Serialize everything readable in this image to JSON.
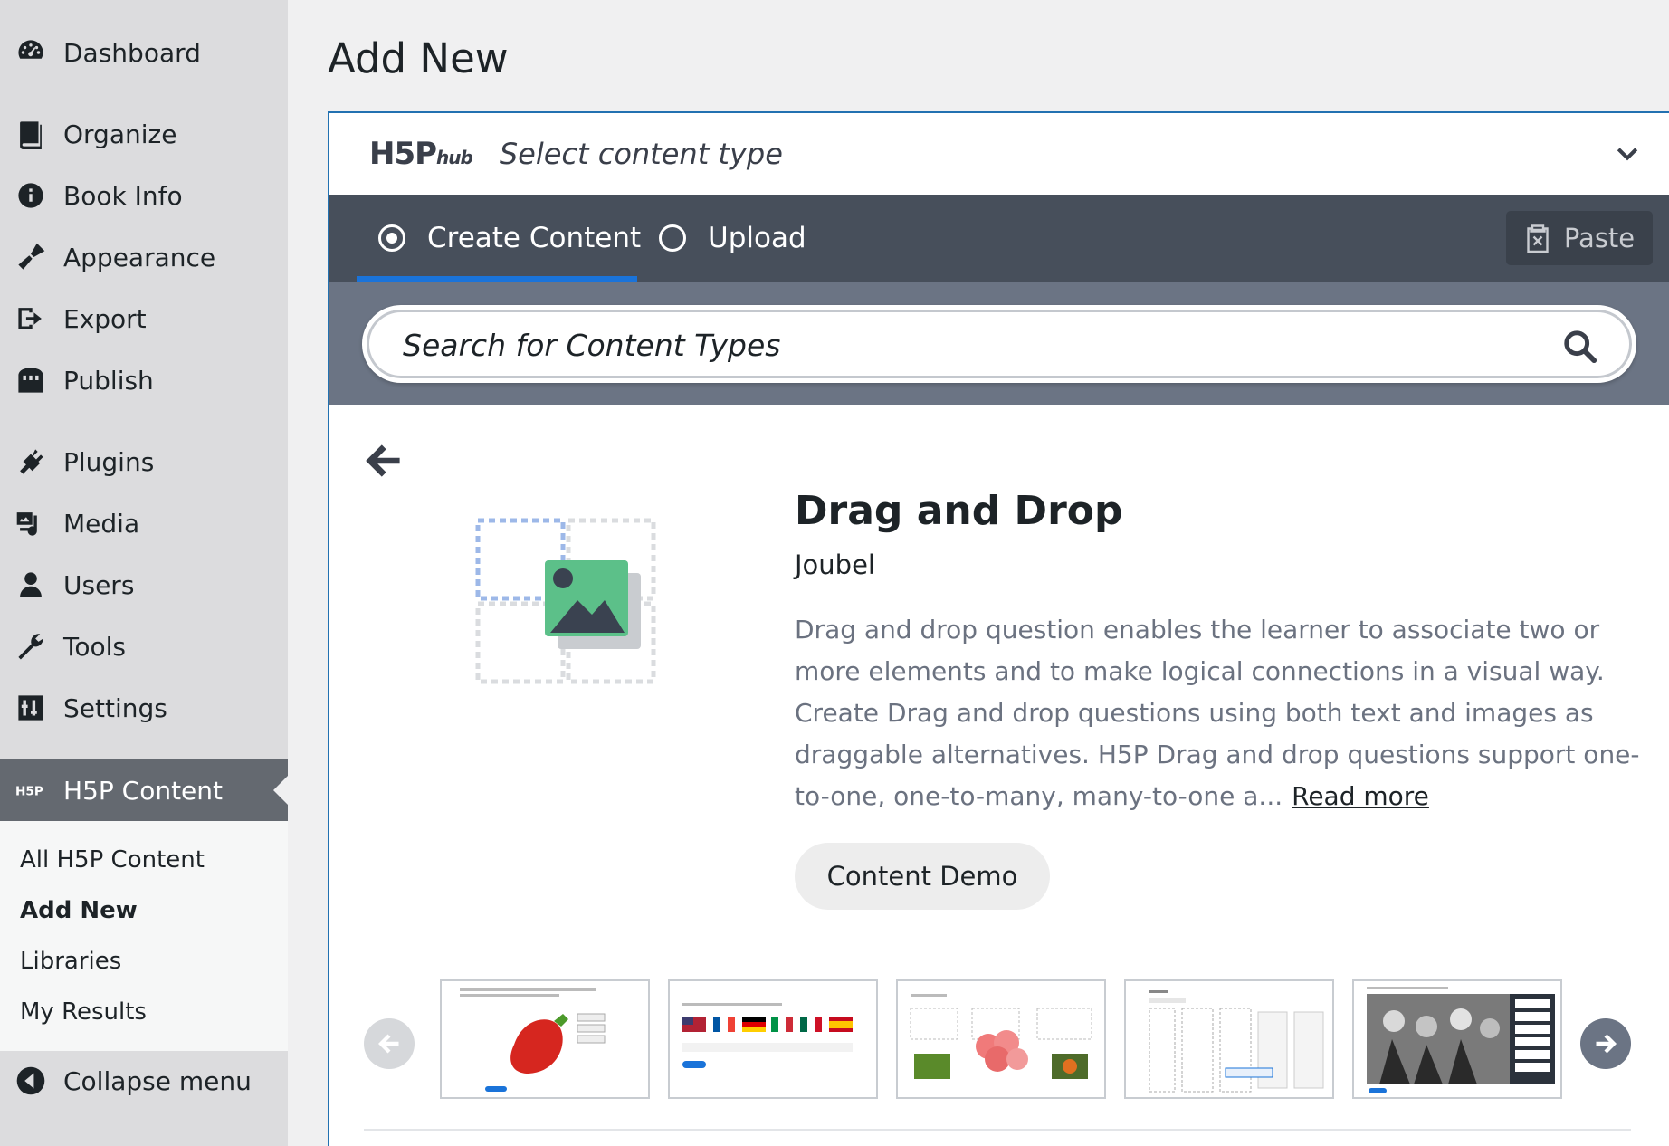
{
  "sidebar": {
    "items": [
      {
        "label": "Dashboard",
        "icon": "dashboard-icon"
      },
      {
        "label": "Organize",
        "icon": "book-icon"
      },
      {
        "label": "Book Info",
        "icon": "info-icon"
      },
      {
        "label": "Appearance",
        "icon": "brush-icon"
      },
      {
        "label": "Export",
        "icon": "export-icon"
      },
      {
        "label": "Publish",
        "icon": "store-icon"
      },
      {
        "label": "Plugins",
        "icon": "plug-icon"
      },
      {
        "label": "Media",
        "icon": "media-icon"
      },
      {
        "label": "Users",
        "icon": "user-icon"
      },
      {
        "label": "Tools",
        "icon": "wrench-icon"
      },
      {
        "label": "Settings",
        "icon": "sliders-icon"
      },
      {
        "label": "H5P Content",
        "icon": "h5p-icon"
      }
    ],
    "submenu": [
      "All H5P Content",
      "Add New",
      "Libraries",
      "My Results"
    ],
    "collapse_label": "Collapse menu"
  },
  "page": {
    "title": "Add New"
  },
  "hub": {
    "logo_main": "H5P",
    "logo_sub": "hub",
    "select_label": "Select content type",
    "tabs": {
      "create": "Create Content",
      "upload": "Upload"
    },
    "paste_label": "Paste",
    "search_placeholder": "Search for Content Types"
  },
  "content_type": {
    "title": "Drag and Drop",
    "owner": "Joubel",
    "description": "Drag and drop question enables the learner to associate two or more elements and to make logical connections in a visual way. Create Drag and drop questions using both text and images as draggable alternatives. H5P Drag and drop questions support one-to-one, one-to-many, many-to-one a...",
    "read_more": "Read more",
    "demo_label": "Content Demo"
  },
  "colors": {
    "accent": "#2271b1",
    "tab_underline": "#1a73d9",
    "tabbar_bg": "#474f5b",
    "searchbar_bg": "#6b7484"
  }
}
